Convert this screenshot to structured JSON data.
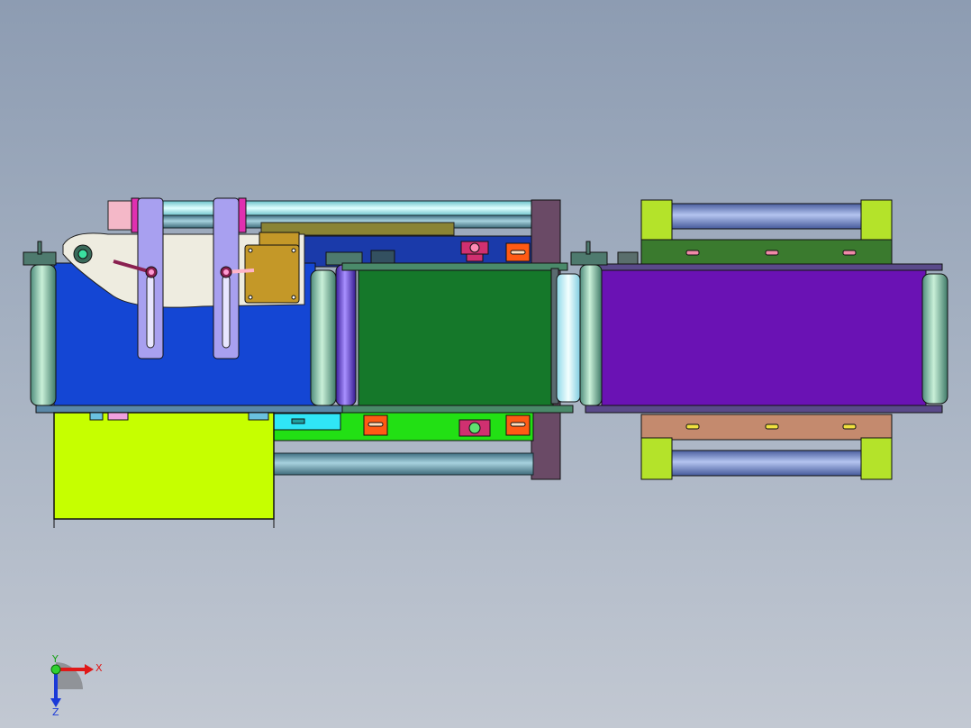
{
  "viewport": {
    "background_top": "#8d9cb2",
    "background_bottom": "#c2c8d2"
  },
  "colors": {
    "left_conveyor_belt": "#1446d4",
    "middle_conveyor_belt": "#15782a",
    "right_conveyor_belt": "#6a12b4",
    "guide_plate": "#eeece0",
    "motor": "#c49828",
    "collection_tray": "#c6ff00",
    "frame_post": "#6a4a66",
    "side_frame_lime": "#b4e32a",
    "side_frame_brown": "#c48a6e",
    "dark_green_rail": "#3a7a2e",
    "roller": "#9ad4b2",
    "shaft": "#5e8ea0"
  },
  "triad": {
    "x_label": "X",
    "y_label": "Y",
    "z_label": "Z"
  }
}
